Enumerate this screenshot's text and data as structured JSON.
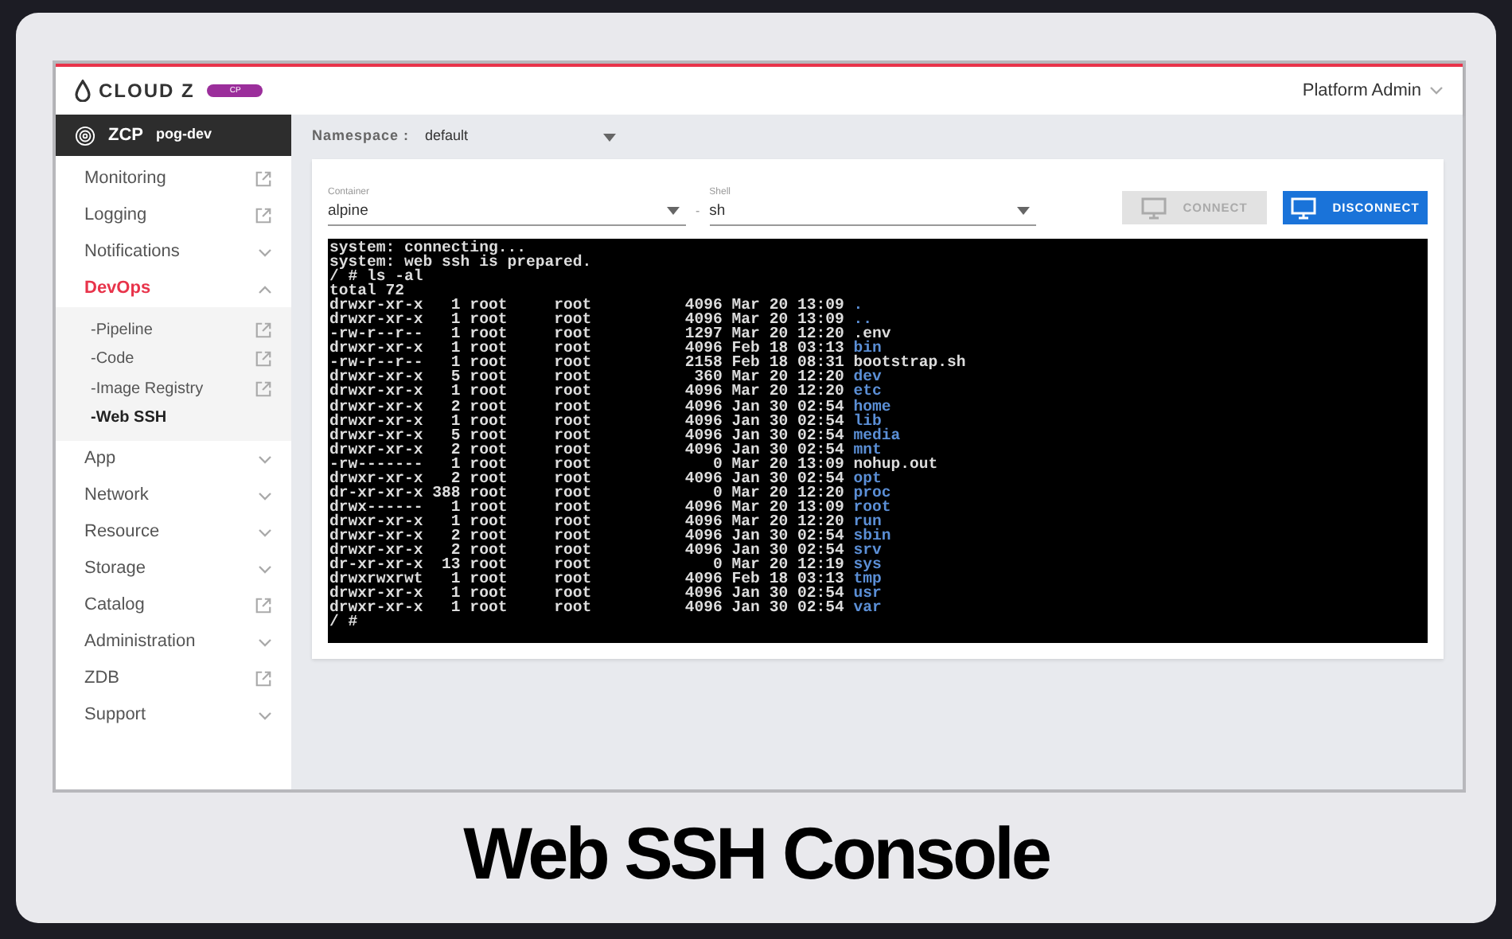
{
  "header": {
    "logo_text": "CLOUD Z",
    "logo_badge": "CP",
    "user": "Platform Admin"
  },
  "sidebar": {
    "product": "ZCP",
    "cluster": "pog-dev",
    "items": [
      {
        "label": "Monitoring",
        "kind": "external",
        "selected": false
      },
      {
        "label": "Logging",
        "kind": "external",
        "selected": false
      },
      {
        "label": "Notifications",
        "kind": "expand",
        "expanded": false,
        "selected": false
      },
      {
        "label": "DevOps",
        "kind": "expand",
        "expanded": true,
        "selected": true,
        "children": [
          {
            "label": "-Pipeline",
            "kind": "external",
            "selected": false
          },
          {
            "label": "-Code",
            "kind": "external",
            "selected": false
          },
          {
            "label": "-Image Registry",
            "kind": "external",
            "selected": false
          },
          {
            "label": "-Web SSH",
            "kind": "plain",
            "selected": true
          }
        ]
      },
      {
        "label": "App",
        "kind": "expand",
        "expanded": false,
        "selected": false
      },
      {
        "label": "Network",
        "kind": "expand",
        "expanded": false,
        "selected": false
      },
      {
        "label": "Resource",
        "kind": "expand",
        "expanded": false,
        "selected": false
      },
      {
        "label": "Storage",
        "kind": "expand",
        "expanded": false,
        "selected": false
      },
      {
        "label": "Catalog",
        "kind": "external",
        "selected": false
      },
      {
        "label": "Administration",
        "kind": "expand",
        "expanded": false,
        "selected": false
      },
      {
        "label": "ZDB",
        "kind": "external",
        "selected": false
      },
      {
        "label": "Support",
        "kind": "expand",
        "expanded": false,
        "selected": false
      }
    ]
  },
  "namespace": {
    "label": "Namespace :",
    "value": "default"
  },
  "container": {
    "label": "Container",
    "value": "alpine"
  },
  "separator": "-",
  "shell": {
    "label": "Shell",
    "value": "sh"
  },
  "buttons": [
    {
      "label": "CONNECT",
      "disabled": true
    },
    {
      "label": "DISCONNECT",
      "disabled": false
    }
  ],
  "terminal": {
    "intro": [
      "system: connecting...",
      "system: web ssh is prepared.",
      "/ # ls -al",
      "total 72"
    ],
    "rows": [
      {
        "perms": "drwxr-xr-x",
        "links": "1",
        "owner": "root",
        "group": "root",
        "size": "4096",
        "date": "Mar 20 13:09",
        "name": ".",
        "kind": "dir"
      },
      {
        "perms": "drwxr-xr-x",
        "links": "1",
        "owner": "root",
        "group": "root",
        "size": "4096",
        "date": "Mar 20 13:09",
        "name": "..",
        "kind": "dir"
      },
      {
        "perms": "-rw-r--r--",
        "links": "1",
        "owner": "root",
        "group": "root",
        "size": "1297",
        "date": "Mar 20 12:20",
        "name": ".env",
        "kind": "file"
      },
      {
        "perms": "drwxr-xr-x",
        "links": "1",
        "owner": "root",
        "group": "root",
        "size": "4096",
        "date": "Feb 18 03:13",
        "name": "bin",
        "kind": "dir"
      },
      {
        "perms": "-rw-r--r--",
        "links": "1",
        "owner": "root",
        "group": "root",
        "size": "2158",
        "date": "Feb 18 08:31",
        "name": "bootstrap.sh",
        "kind": "file"
      },
      {
        "perms": "drwxr-xr-x",
        "links": "5",
        "owner": "root",
        "group": "root",
        "size": "360",
        "date": "Mar 20 12:20",
        "name": "dev",
        "kind": "dir"
      },
      {
        "perms": "drwxr-xr-x",
        "links": "1",
        "owner": "root",
        "group": "root",
        "size": "4096",
        "date": "Mar 20 12:20",
        "name": "etc",
        "kind": "dir"
      },
      {
        "perms": "drwxr-xr-x",
        "links": "2",
        "owner": "root",
        "group": "root",
        "size": "4096",
        "date": "Jan 30 02:54",
        "name": "home",
        "kind": "dir"
      },
      {
        "perms": "drwxr-xr-x",
        "links": "1",
        "owner": "root",
        "group": "root",
        "size": "4096",
        "date": "Jan 30 02:54",
        "name": "lib",
        "kind": "dir"
      },
      {
        "perms": "drwxr-xr-x",
        "links": "5",
        "owner": "root",
        "group": "root",
        "size": "4096",
        "date": "Jan 30 02:54",
        "name": "media",
        "kind": "dir"
      },
      {
        "perms": "drwxr-xr-x",
        "links": "2",
        "owner": "root",
        "group": "root",
        "size": "4096",
        "date": "Jan 30 02:54",
        "name": "mnt",
        "kind": "dir"
      },
      {
        "perms": "-rw-------",
        "links": "1",
        "owner": "root",
        "group": "root",
        "size": "0",
        "date": "Mar 20 13:09",
        "name": "nohup.out",
        "kind": "file"
      },
      {
        "perms": "drwxr-xr-x",
        "links": "2",
        "owner": "root",
        "group": "root",
        "size": "4096",
        "date": "Jan 30 02:54",
        "name": "opt",
        "kind": "dir"
      },
      {
        "perms": "dr-xr-xr-x",
        "links": "388",
        "owner": "root",
        "group": "root",
        "size": "0",
        "date": "Mar 20 12:20",
        "name": "proc",
        "kind": "dir"
      },
      {
        "perms": "drwx------",
        "links": "1",
        "owner": "root",
        "group": "root",
        "size": "4096",
        "date": "Mar 20 13:09",
        "name": "root",
        "kind": "dir"
      },
      {
        "perms": "drwxr-xr-x",
        "links": "1",
        "owner": "root",
        "group": "root",
        "size": "4096",
        "date": "Mar 20 12:20",
        "name": "run",
        "kind": "dir"
      },
      {
        "perms": "drwxr-xr-x",
        "links": "2",
        "owner": "root",
        "group": "root",
        "size": "4096",
        "date": "Jan 30 02:54",
        "name": "sbin",
        "kind": "dir"
      },
      {
        "perms": "drwxr-xr-x",
        "links": "2",
        "owner": "root",
        "group": "root",
        "size": "4096",
        "date": "Jan 30 02:54",
        "name": "srv",
        "kind": "dir"
      },
      {
        "perms": "dr-xr-xr-x",
        "links": "13",
        "owner": "root",
        "group": "root",
        "size": "0",
        "date": "Mar 20 12:19",
        "name": "sys",
        "kind": "dir"
      },
      {
        "perms": "drwxrwxrwt",
        "links": "1",
        "owner": "root",
        "group": "root",
        "size": "4096",
        "date": "Feb 18 03:13",
        "name": "tmp",
        "kind": "dir"
      },
      {
        "perms": "drwxr-xr-x",
        "links": "1",
        "owner": "root",
        "group": "root",
        "size": "4096",
        "date": "Jan 30 02:54",
        "name": "usr",
        "kind": "dir"
      },
      {
        "perms": "drwxr-xr-x",
        "links": "1",
        "owner": "root",
        "group": "root",
        "size": "4096",
        "date": "Jan 30 02:54",
        "name": "var",
        "kind": "dir"
      }
    ],
    "prompt": "/ #"
  },
  "caption": "Web SSH Console"
}
